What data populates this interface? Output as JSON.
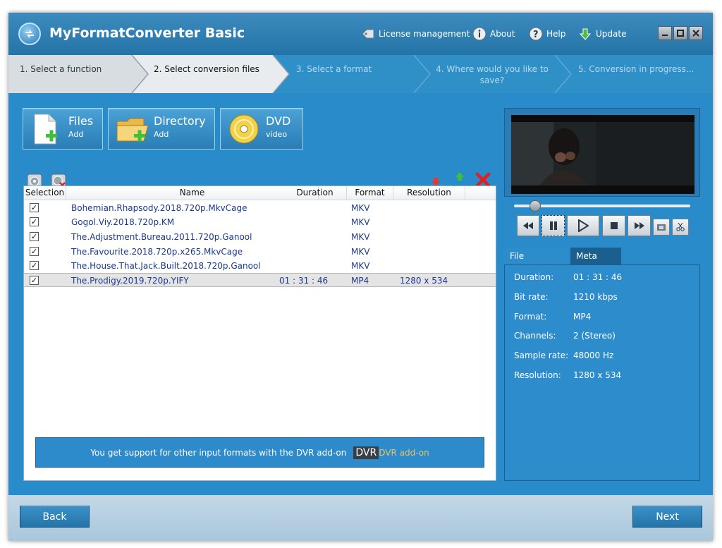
{
  "app": {
    "title": "MyFormatConverter Basic",
    "menu": {
      "license": "License management",
      "about": "About",
      "help": "Help",
      "update": "Update"
    }
  },
  "steps": [
    {
      "label": "1. Select a function"
    },
    {
      "label": "2. Select conversion files"
    },
    {
      "label": "3. Select a format"
    },
    {
      "label": "4. Where would you like to save?"
    },
    {
      "label": "5. Conversion in progress..."
    }
  ],
  "sources": {
    "files": {
      "label": "Files",
      "sub": "Add"
    },
    "directory": {
      "label": "Directory",
      "sub": "Add"
    },
    "dvd": {
      "label": "DVD",
      "sub": "video"
    }
  },
  "table": {
    "columns": {
      "selection": "Selection",
      "name": "Name",
      "duration": "Duration",
      "format": "Format",
      "resolution": "Resolution"
    },
    "rows": [
      {
        "name": "Bohemian.Rhapsody.2018.720p.MkvCage",
        "duration": "",
        "format": "MKV",
        "resolution": "",
        "check": "✓"
      },
      {
        "name": "Gogol.Viy.2018.720p.KM",
        "duration": "",
        "format": "MKV",
        "resolution": "",
        "check": "✓"
      },
      {
        "name": "The.Adjustment.Bureau.2011.720p.Ganool",
        "duration": "",
        "format": "MKV",
        "resolution": "",
        "check": "✓"
      },
      {
        "name": "The.Favourite.2018.720p.x265.MkvCage",
        "duration": "",
        "format": "MKV",
        "resolution": "",
        "check": "✓"
      },
      {
        "name": "The.House.That.Jack.Built.2018.720p.Ganool",
        "duration": "",
        "format": "MKV",
        "resolution": "",
        "check": "✓"
      },
      {
        "name": "The.Prodigy.2019.720p.YIFY",
        "duration": "01 : 31 : 46",
        "format": "MP4",
        "resolution": "1280 x 534",
        "check": "✓"
      }
    ]
  },
  "promo": {
    "text": "You get support for other input formats with the DVR add-on",
    "badge": "DVR",
    "link": "DVR add-on"
  },
  "player": {
    "seek_position": 0.12
  },
  "props_tabs": {
    "file_properties": "File properties",
    "meta_info": "Meta info"
  },
  "properties": [
    {
      "label": "Duration:",
      "value": "01 : 31 : 46"
    },
    {
      "label": "Bit rate:",
      "value": "1210 kbps"
    },
    {
      "label": "Format:",
      "value": "MP4"
    },
    {
      "label": "Channels:",
      "value": "2 (Stereo)"
    },
    {
      "label": "Sample rate:",
      "value": "48000 Hz"
    },
    {
      "label": "Resolution:",
      "value": "1280 x 534"
    }
  ],
  "footer": {
    "back": "Back",
    "next": "Next"
  }
}
